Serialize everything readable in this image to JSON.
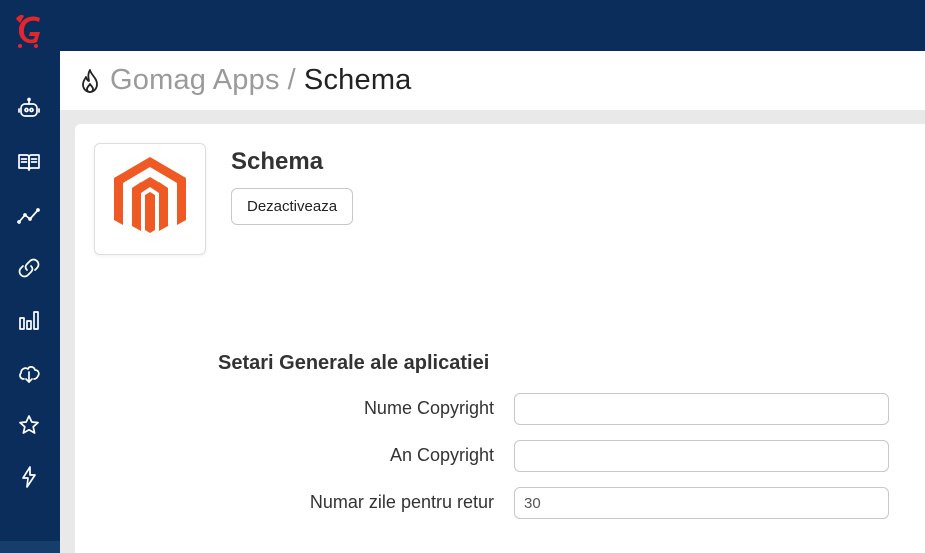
{
  "colors": {
    "sidebar": "#0a2d5c",
    "brand_red": "#e3262c",
    "magento_orange": "#ef5a24"
  },
  "sidebar": {
    "logo": "gomag-logo",
    "items": [
      {
        "icon": "robot-icon"
      },
      {
        "icon": "book-icon"
      },
      {
        "icon": "trend-line-icon"
      },
      {
        "icon": "link-icon"
      },
      {
        "icon": "bar-chart-icon"
      },
      {
        "icon": "cloud-download-icon"
      },
      {
        "icon": "star-icon"
      },
      {
        "icon": "lightning-icon"
      }
    ]
  },
  "header": {
    "icon": "fire-icon",
    "breadcrumb_root": "Gomag Apps",
    "breadcrumb_sep": "/",
    "breadcrumb_current": "Schema"
  },
  "app": {
    "logo_icon": "magento-logo-icon",
    "title": "Schema",
    "deactivate_label": "Dezactiveaza"
  },
  "settings": {
    "title": "Setari Generale ale aplicatiei",
    "fields": [
      {
        "label": "Nume Copyright",
        "value": ""
      },
      {
        "label": "An Copyright",
        "value": ""
      },
      {
        "label": "Numar zile pentru retur",
        "value": "30"
      }
    ]
  }
}
